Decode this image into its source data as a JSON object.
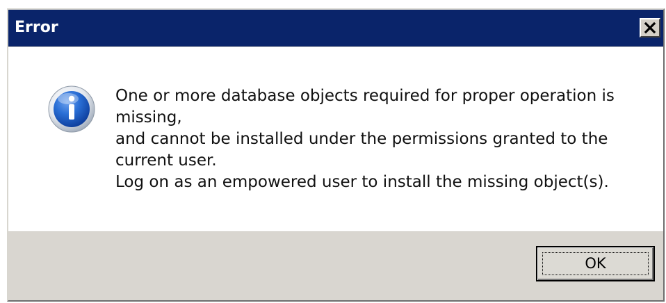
{
  "window": {
    "title": "Error",
    "close_icon": "close-x-icon"
  },
  "message": {
    "icon": "information-icon",
    "lines": [
      "One or more database objects required for proper operation is",
      "missing,",
      "and cannot be installed under the permissions granted to the",
      "current user.",
      "Log on as an empowered user to install the missing object(s)."
    ]
  },
  "buttons": {
    "ok_label": "OK"
  },
  "colors": {
    "titlebar": "#0a246a",
    "footer": "#d9d6d0",
    "icon_blue": "#1d5fc4"
  }
}
